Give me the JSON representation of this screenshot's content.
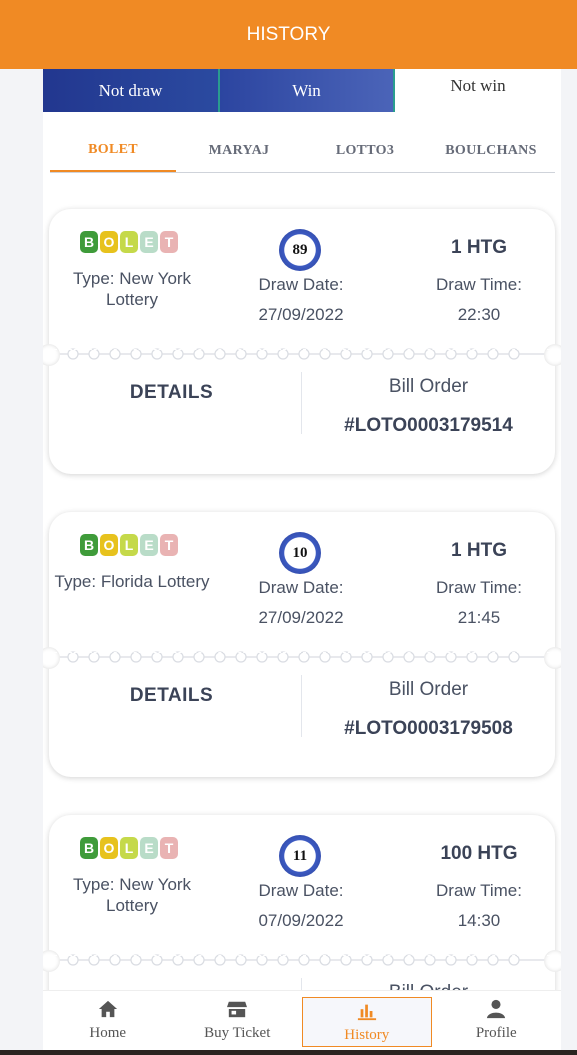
{
  "header": {
    "title": "HISTORY"
  },
  "status_tabs": [
    {
      "label": "Not draw"
    },
    {
      "label": "Win"
    },
    {
      "label": "Not win"
    }
  ],
  "game_tabs": [
    {
      "label": "BOLET",
      "active": true
    },
    {
      "label": "MARYAJ",
      "active": false
    },
    {
      "label": "LOTTO3",
      "active": false
    },
    {
      "label": "BOULCHANS",
      "active": false
    }
  ],
  "logo_letters": [
    "B",
    "O",
    "L",
    "E",
    "T"
  ],
  "logo_colors": [
    "#3f9b3a",
    "#e7c21d",
    "#c5d94a",
    "#b9dcc8",
    "#e9b3b3"
  ],
  "labels": {
    "draw_date": "Draw Date:",
    "draw_time": "Draw Time:",
    "details": "DETAILS",
    "bill_order": "Bill Order"
  },
  "tickets": [
    {
      "type": "Type: New York Lottery",
      "ball": "89",
      "date": "27/09/2022",
      "amount": "1 HTG",
      "time": "22:30",
      "bill": "#LOTO0003179514"
    },
    {
      "type": "Type: Florida Lottery",
      "ball": "10",
      "date": "27/09/2022",
      "amount": "1 HTG",
      "time": "21:45",
      "bill": "#LOTO0003179508"
    },
    {
      "type": "Type: New York Lottery",
      "ball": "11",
      "date": "07/09/2022",
      "amount": "100 HTG",
      "time": "14:30",
      "bill": ""
    }
  ],
  "nav": [
    {
      "label": "Home",
      "icon": "home-icon"
    },
    {
      "label": "Buy Ticket",
      "icon": "store-icon"
    },
    {
      "label": "History",
      "icon": "chart-icon",
      "active": true
    },
    {
      "label": "Profile",
      "icon": "user-icon"
    }
  ],
  "colors": {
    "accent": "#f08a24",
    "tab_blue": "#22378f"
  }
}
